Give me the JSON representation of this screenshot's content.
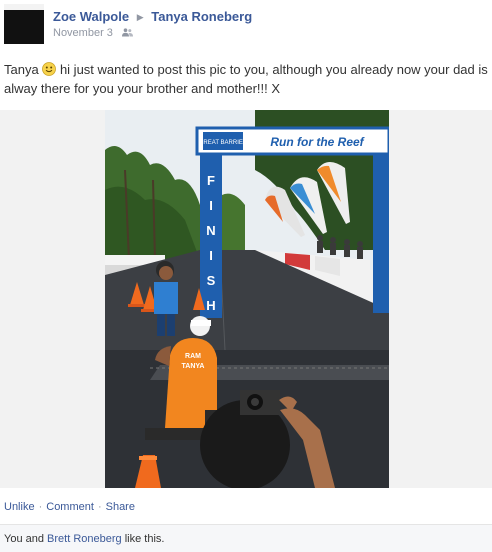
{
  "post": {
    "author": "Zoe Walpole",
    "target": "Tanya Roneberg",
    "date": "November 3",
    "privacy_icon": "friends-icon",
    "message_name": "Tanya",
    "message_body": "hi just wanted to post this pic to you, although you already now your dad is alway there for you your brother and mother!!! X",
    "emoticon": "smiley-icon"
  },
  "photo": {
    "arch_banner": "Run for the Reef",
    "finish_text": "FINISH",
    "shirt_line1": "RAM",
    "shirt_line2": "TANYA"
  },
  "actions": {
    "unlike": "Unlike",
    "comment": "Comment",
    "share": "Share",
    "separator": "·"
  },
  "likes": {
    "you": "You",
    "and": "and",
    "liker": "Brett Roneberg",
    "suffix": "like this."
  },
  "colors": {
    "link": "#3b5998",
    "meta": "#9197a3"
  }
}
